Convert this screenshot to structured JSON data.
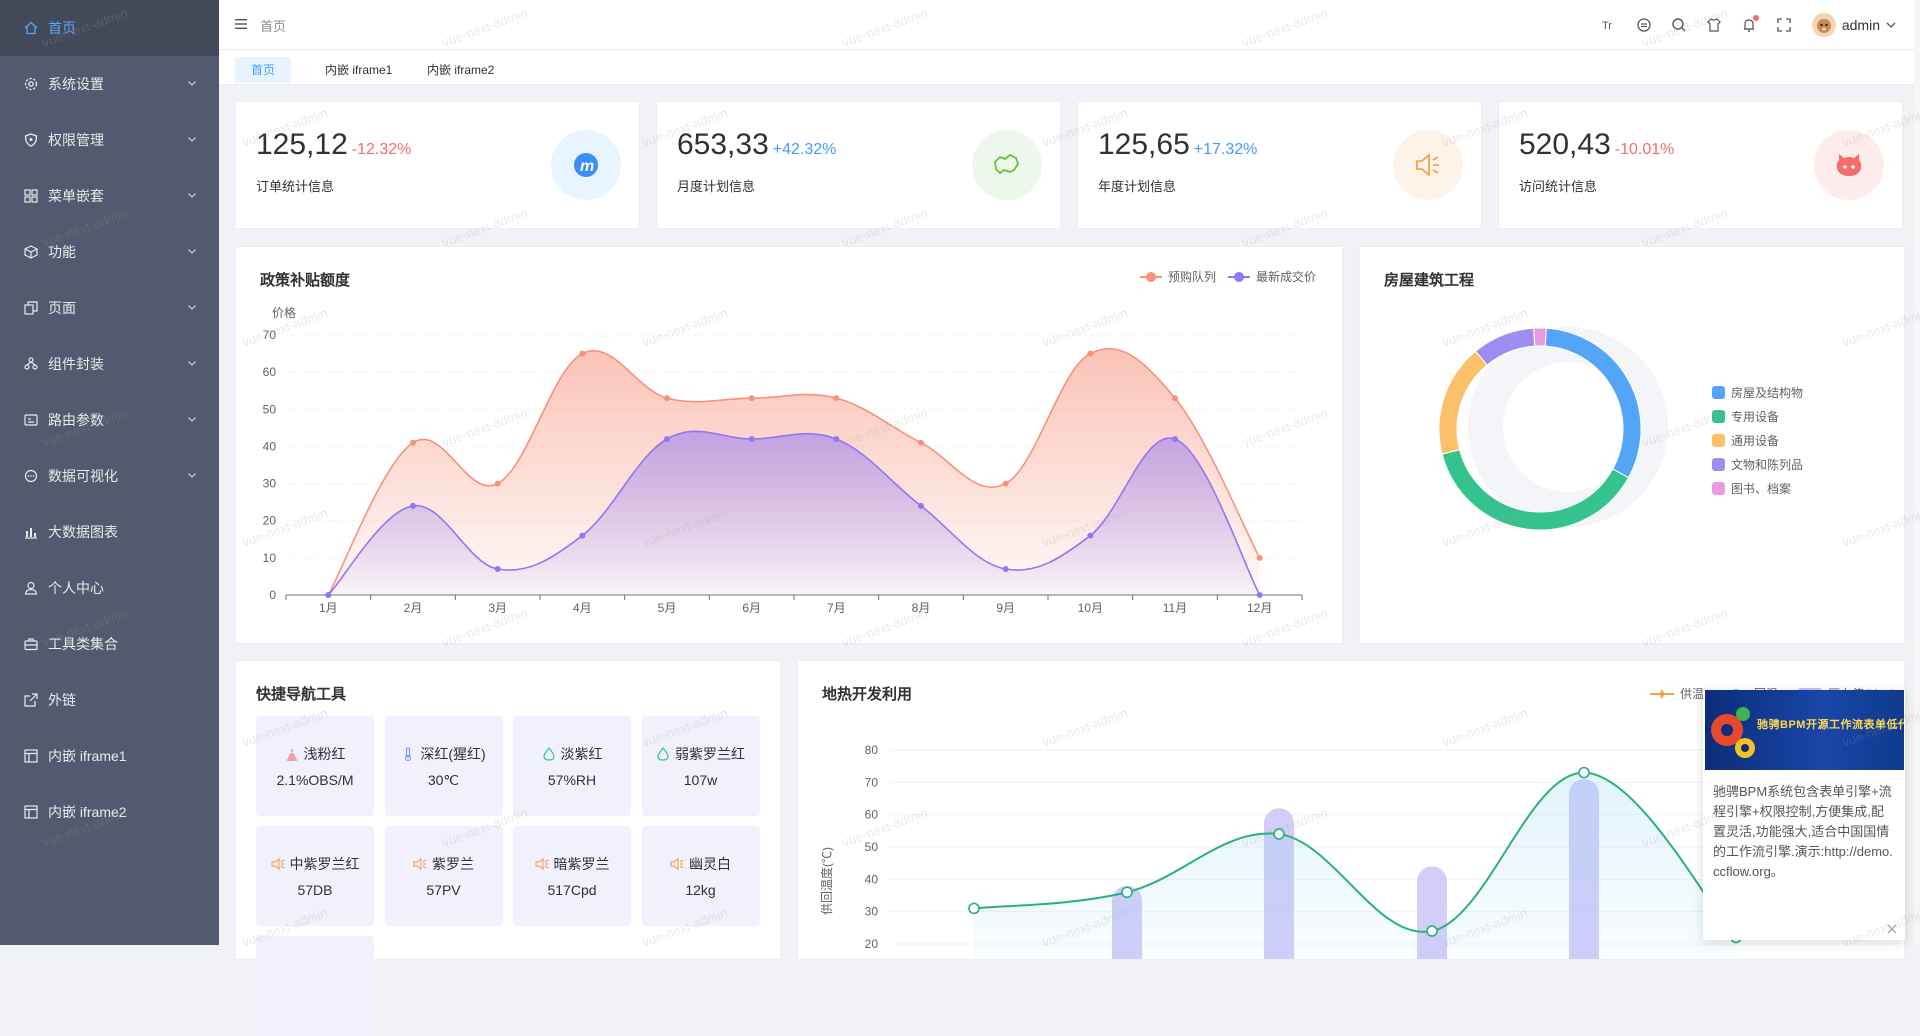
{
  "sidebar": {
    "items": [
      {
        "label": "首页",
        "icon": "home-icon",
        "active": true,
        "expandable": false
      },
      {
        "label": "系统设置",
        "icon": "gear-icon",
        "expandable": true
      },
      {
        "label": "权限管理",
        "icon": "shield-icon",
        "expandable": true
      },
      {
        "label": "菜单嵌套",
        "icon": "grid-icon",
        "expandable": true
      },
      {
        "label": "功能",
        "icon": "cube-icon",
        "expandable": true
      },
      {
        "label": "页面",
        "icon": "copy-icon",
        "expandable": true
      },
      {
        "label": "组件封装",
        "icon": "components-icon",
        "expandable": true
      },
      {
        "label": "路由参数",
        "icon": "route-icon",
        "expandable": true
      },
      {
        "label": "数据可视化",
        "icon": "chat-icon",
        "expandable": true
      },
      {
        "label": "大数据图表",
        "icon": "bar-chart-icon",
        "expandable": false
      },
      {
        "label": "个人中心",
        "icon": "user-icon",
        "expandable": false
      },
      {
        "label": "工具类集合",
        "icon": "briefcase-icon",
        "expandable": false
      },
      {
        "label": "外链",
        "icon": "external-link-icon",
        "expandable": false
      },
      {
        "label": "内嵌 iframe1",
        "icon": "window-icon",
        "expandable": false
      },
      {
        "label": "内嵌 iframe2",
        "icon": "window-icon",
        "expandable": false
      }
    ]
  },
  "header": {
    "breadcrumb": "首页",
    "user": "admin",
    "tools": [
      "font-size-icon",
      "palette-icon",
      "search-icon",
      "theme-shirt-icon",
      "bell-icon",
      "fullscreen-icon"
    ]
  },
  "tabs": [
    "首页",
    "内嵌 iframe1",
    "内嵌 iframe2"
  ],
  "stats": [
    {
      "value": "125,12",
      "change": "-12.32%",
      "label": "订单统计信息",
      "change_color": "#f56c6c",
      "icon": "m-logo-icon",
      "icon_bg": "#e8f4ff"
    },
    {
      "value": "653,33",
      "change": "+42.32%",
      "label": "月度计划信息",
      "change_color": "#409eff",
      "icon": "map-icon",
      "icon_bg": "#edf7ec"
    },
    {
      "value": "125,65",
      "change": "+17.32%",
      "label": "年度计划信息",
      "change_color": "#409eff",
      "icon": "speaker-icon",
      "icon_bg": "#fdf3e8"
    },
    {
      "value": "520,43",
      "change": "-10.01%",
      "label": "访问统计信息",
      "change_color": "#f56c6c",
      "icon": "github-cat-icon",
      "icon_bg": "#feecec"
    }
  ],
  "policy_chart": {
    "title": "政策补贴额度",
    "chart_data": {
      "type": "area",
      "ylabel": "价格",
      "categories": [
        "1月",
        "2月",
        "3月",
        "4月",
        "5月",
        "6月",
        "7月",
        "8月",
        "9月",
        "10月",
        "11月",
        "12月"
      ],
      "ylim": [
        0,
        70
      ],
      "yticks": [
        0,
        10,
        20,
        30,
        40,
        50,
        60,
        70
      ],
      "legend_position": "top-right",
      "series": [
        {
          "name": "预购队列",
          "color": "#f8917a",
          "values": [
            0,
            41,
            30,
            65,
            53,
            53,
            53,
            41,
            30,
            65,
            53,
            10
          ]
        },
        {
          "name": "最新成交价",
          "color": "#9277f2",
          "values": [
            0,
            24,
            7,
            16,
            42,
            42,
            42,
            24,
            7,
            16,
            42,
            0
          ]
        }
      ]
    }
  },
  "building_chart": {
    "title": "房屋建筑工程",
    "chart_data": {
      "type": "pie",
      "legend_position": "right",
      "slices": [
        {
          "name": "房屋及结构物",
          "value": 32,
          "color": "#52a5f7"
        },
        {
          "name": "专用设备",
          "value": 38,
          "color": "#34c38f"
        },
        {
          "name": "通用设备",
          "value": 18,
          "color": "#fbc069"
        },
        {
          "name": "文物和陈列品",
          "value": 10,
          "color": "#9d8df1"
        },
        {
          "name": "图书、档案",
          "value": 2,
          "color": "#e99ae2"
        }
      ]
    }
  },
  "quick_nav": {
    "title": "快捷导航工具",
    "items": [
      {
        "label": "浅粉红",
        "value": "2.1%OBS/M",
        "icon": "gauge-icon",
        "color": "#f56c6c"
      },
      {
        "label": "深红(猩红)",
        "value": "30℃",
        "icon": "thermometer-icon",
        "color": "#7b9cf5"
      },
      {
        "label": "淡紫红",
        "value": "57%RH",
        "icon": "droplet-icon",
        "color": "#34c38f"
      },
      {
        "label": "弱紫罗兰红",
        "value": "107w",
        "icon": "droplet-icon",
        "color": "#34c38f"
      },
      {
        "label": "中紫罗兰红",
        "value": "57DB",
        "icon": "speaker-icon",
        "color": "#f8a35a"
      },
      {
        "label": "紫罗兰",
        "value": "57PV",
        "icon": "speaker-icon",
        "color": "#f8a35a"
      },
      {
        "label": "暗紫罗兰",
        "value": "517Cpd",
        "icon": "speaker-icon",
        "color": "#f8a35a"
      },
      {
        "label": "幽灵白",
        "value": "12kg",
        "icon": "speaker-icon",
        "color": "#f8a35a"
      }
    ]
  },
  "geo_chart": {
    "title": "地热开发利用",
    "chart_data": {
      "type": "line",
      "ylabel": "供回温度(℃)",
      "ylim": [
        20,
        80
      ],
      "yticks": [
        20,
        30,
        40,
        50,
        60,
        70,
        80
      ],
      "legend": [
        "供温",
        "回温",
        "压力值(Mpa)"
      ],
      "legend_position": "top-right",
      "series": [
        {
          "name": "回温",
          "color": "#2ab07d",
          "values": [
            31,
            36,
            54,
            24,
            73,
            22
          ]
        },
        {
          "name": "压力值(Mpa)",
          "color": "#c7c2f5",
          "values": [
            null,
            38,
            62,
            44,
            71,
            null
          ]
        }
      ],
      "right_axis_visible_tick": "20"
    }
  },
  "popup": {
    "heading": "驰骋BPM开源工作流表单低代码开发平台",
    "text": "驰骋BPM系统包含表单引擎+流程引擎+权限控制,方便集成,配置灵活,功能强大,适合中国国情的工作流引擎.演示:http://demo.ccflow.org。"
  },
  "watermark": "vue-next-admin"
}
